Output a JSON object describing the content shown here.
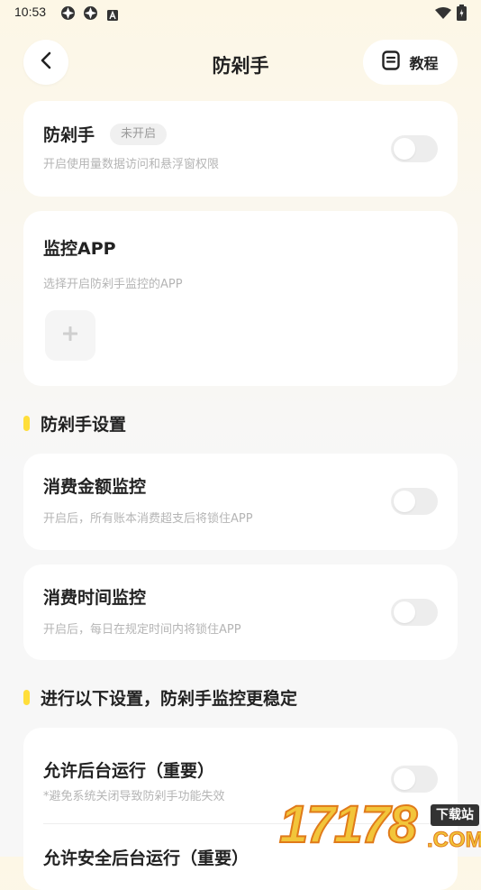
{
  "status_bar": {
    "time": "10:53",
    "icons": [
      "aperture-icon",
      "aperture-icon",
      "a-badge-icon",
      "wifi-icon",
      "battery-icon"
    ]
  },
  "header": {
    "title": "防剁手",
    "tutorial_label": "教程",
    "icons": {
      "back": "chevron-left-icon",
      "tutorial": "document-icon"
    }
  },
  "guard_card": {
    "title": "防剁手",
    "badge": "未开启",
    "subtitle": "开启使用量数据访问和悬浮窗权限",
    "toggle_on": false
  },
  "monitor_card": {
    "title": "监控APP",
    "subtitle": "选择开启防剁手监控的APP",
    "add_icon": "plus-icon"
  },
  "settings_section": {
    "heading": "防剁手设置",
    "rows": [
      {
        "title": "消费金额监控",
        "subtitle": "开启后，所有账本消费超支后将锁住APP",
        "toggle_on": false
      },
      {
        "title": "消费时间监控",
        "subtitle": "开启后，每日在规定时间内将锁住APP",
        "toggle_on": false
      }
    ]
  },
  "stability_section": {
    "heading": "进行以下设置，防剁手监控更稳定",
    "rows": [
      {
        "title": "允许后台运行（重要）",
        "subtitle": "*避免系统关闭导致防剁手功能失效",
        "toggle_on": false
      },
      {
        "title": "允许安全后台运行（重要）"
      }
    ]
  },
  "watermark": {
    "digits": "17178",
    "tag": "下载站",
    "domain": ".COM"
  },
  "colors": {
    "accent": "#ffde3a",
    "page_bg": "#f7f7f7",
    "card_bg": "#ffffff",
    "toggle_off": "#ededed"
  }
}
